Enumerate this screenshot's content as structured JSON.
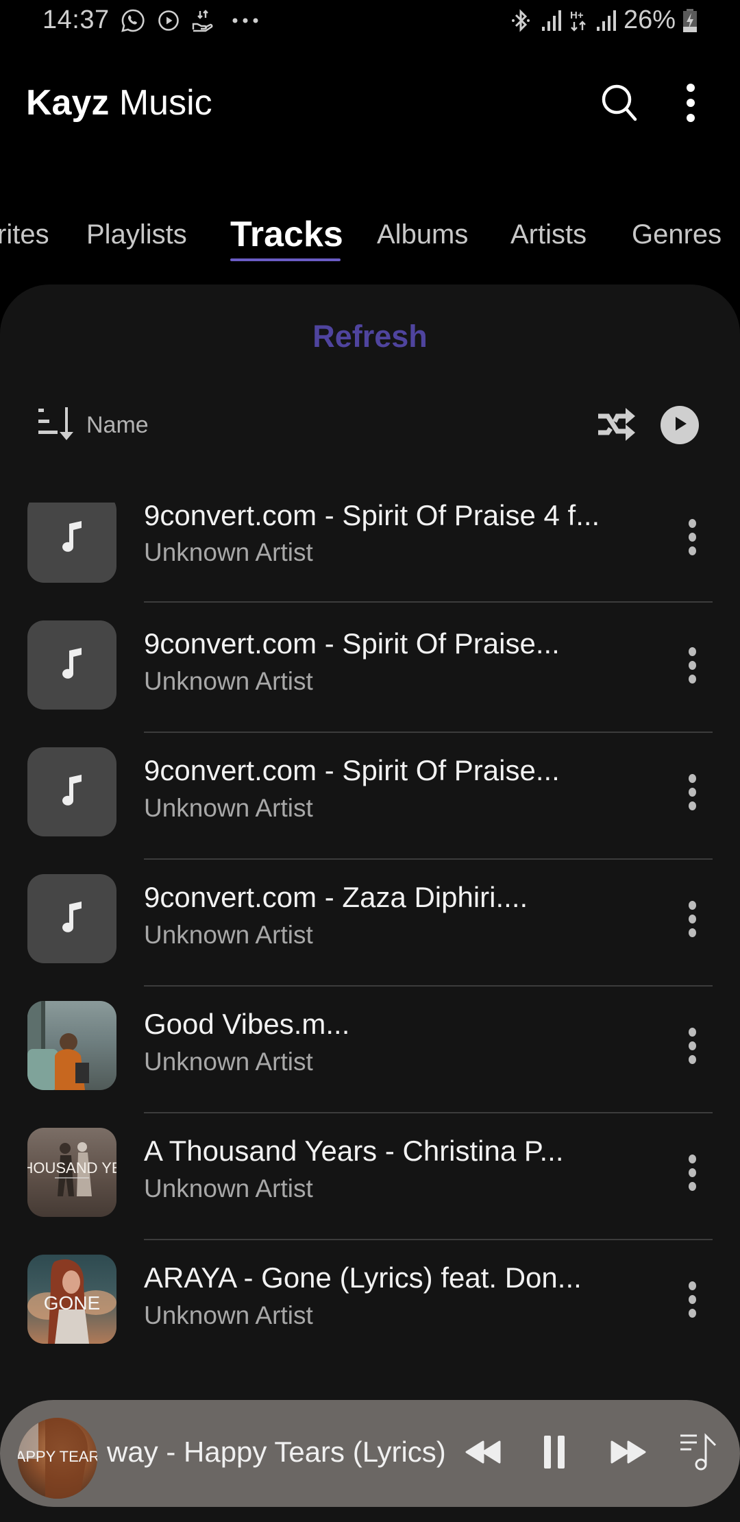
{
  "status_bar": {
    "time": "14:37",
    "left_icons": [
      "whatsapp-icon",
      "play-circle-icon",
      "data-transfer-icon",
      "more-notifications-icon"
    ],
    "right_icons": [
      "bluetooth-icon",
      "signal-icon",
      "h-plus-data-icon",
      "signal-icon"
    ],
    "battery_percent": "26%",
    "battery_state": "charging"
  },
  "app_bar": {
    "title_bold": "Kayz",
    "title_regular": "Music",
    "search_icon": "search-icon",
    "menu_icon": "more-vertical-icon"
  },
  "tabs": {
    "items": [
      {
        "label": "rites",
        "full_label": "Favorites",
        "active": false
      },
      {
        "label": "Playlists",
        "active": false
      },
      {
        "label": "Tracks",
        "active": true
      },
      {
        "label": "Albums",
        "active": false
      },
      {
        "label": "Artists",
        "active": false
      },
      {
        "label": "Genres",
        "active": false
      }
    ],
    "accent_color": "#6a5cc4"
  },
  "panel": {
    "refresh_label": "Refresh",
    "refresh_color": "#4f449e",
    "sort_label": "Name",
    "sort_icon": "sort-descending-icon",
    "shuffle_icon": "shuffle-icon",
    "play_all_icon": "play-circle-icon"
  },
  "tracks": [
    {
      "title": "9convert.com - Spirit Of Praise 4 f...",
      "artist": "Unknown Artist",
      "art": "placeholder-note"
    },
    {
      "title": "9convert.com - Spirit Of Praise...",
      "artist": "Unknown Artist",
      "art": "placeholder-note"
    },
    {
      "title": "9convert.com - Spirit Of Praise...",
      "artist": "Unknown Artist",
      "art": "placeholder-note"
    },
    {
      "title": "9convert.com - Zaza  Diphiri....",
      "artist": "Unknown Artist",
      "art": "placeholder-note"
    },
    {
      "title": "Good Vibes.m...",
      "artist": "Unknown Artist",
      "art": "photo-window-seat"
    },
    {
      "title": "A Thousand Years - Christina P...",
      "artist": "Unknown Artist",
      "art": "photo-thousand-years",
      "art_text": "HOUSAND YE"
    },
    {
      "title": "ARAYA - Gone (Lyrics) feat. Don...",
      "artist": "Unknown Artist",
      "art": "photo-gone",
      "art_text": "GONE"
    }
  ],
  "mini_player": {
    "title": "way - Happy Tears (Lyrics)",
    "art_text": "APPY TEAR",
    "state": "playing",
    "buttons": [
      "rewind-icon",
      "pause-icon",
      "fast-forward-icon",
      "queue-music-icon"
    ],
    "background": "#6b6764"
  }
}
